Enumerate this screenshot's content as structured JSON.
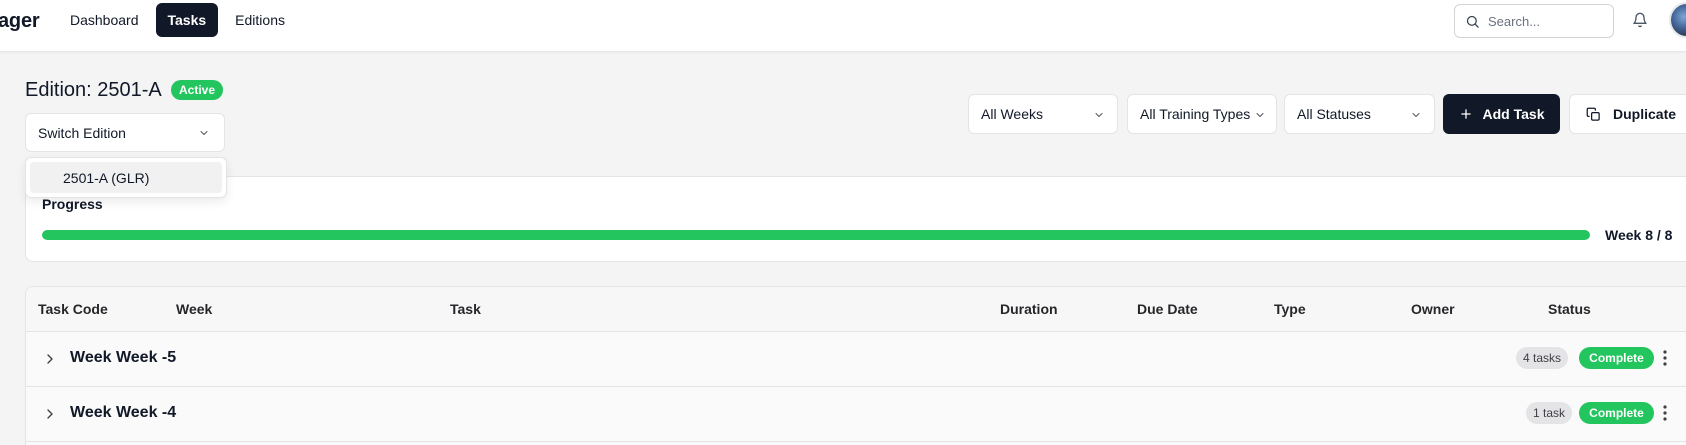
{
  "app": {
    "brand": "ager"
  },
  "nav": {
    "items": [
      {
        "label": "Dashboard"
      },
      {
        "label": "Tasks"
      },
      {
        "label": "Editions"
      }
    ]
  },
  "header": {
    "search_placeholder": "Search..."
  },
  "edition": {
    "title": "Edition: 2501-A",
    "status": "Active",
    "switch_label": "Switch Edition",
    "options": [
      "2501-A (GLR)"
    ]
  },
  "filters": {
    "weeks": "All Weeks",
    "training_types": "All Training Types",
    "statuses": "All Statuses"
  },
  "actions": {
    "add_task": "Add Task",
    "duplicate": "Duplicate"
  },
  "progress": {
    "label": "Progress",
    "week_text": "Week 8 / 8",
    "value": 1.0
  },
  "table": {
    "columns": [
      "Task Code",
      "Week",
      "Task",
      "Duration",
      "Due Date",
      "Type",
      "Owner",
      "Status"
    ],
    "groups": [
      {
        "title": "Week Week -5",
        "count": "4 tasks",
        "status": "Complete"
      },
      {
        "title": "Week Week -4",
        "count": "1 task",
        "status": "Complete"
      }
    ]
  },
  "colors": {
    "accent": "#111827",
    "success": "#22c55e",
    "background": "#f4f4f5"
  }
}
